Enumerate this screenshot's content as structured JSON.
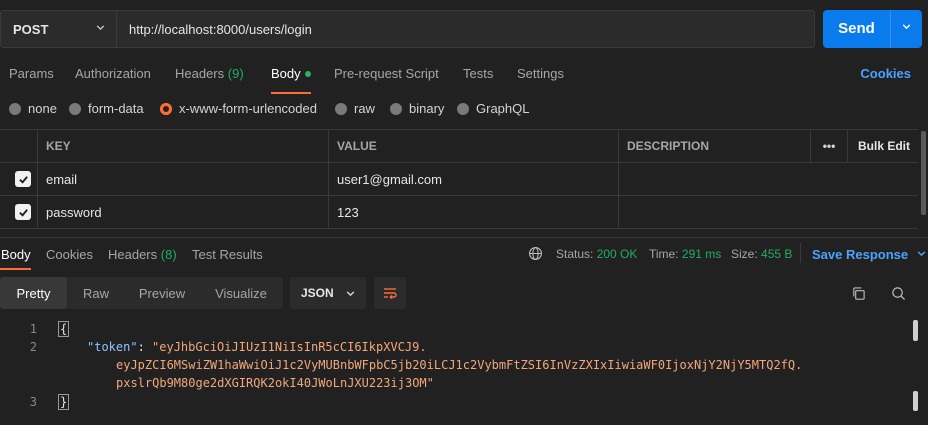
{
  "request": {
    "method": "POST",
    "url": "http://localhost:8000/users/login",
    "send_label": "Send"
  },
  "request_tabs": {
    "params": "Params",
    "authorization": "Authorization",
    "headers": "Headers",
    "headers_count": "(9)",
    "body": "Body",
    "prerequest": "Pre-request Script",
    "tests": "Tests",
    "settings": "Settings",
    "cookies": "Cookies"
  },
  "body_types": {
    "none": "none",
    "form_data": "form-data",
    "urlencoded": "x-www-form-urlencoded",
    "raw": "raw",
    "binary": "binary",
    "graphql": "GraphQL",
    "selected": "x-www-form-urlencoded"
  },
  "params_table": {
    "headers": {
      "key": "KEY",
      "value": "VALUE",
      "description": "DESCRIPTION",
      "more": "•••",
      "bulk_edit": "Bulk Edit"
    },
    "rows": [
      {
        "key": "email",
        "value": "user1@gmail.com",
        "checked": true
      },
      {
        "key": "password",
        "value": "123",
        "checked": true
      }
    ]
  },
  "response_tabs": {
    "body": "Body",
    "cookies": "Cookies",
    "headers": "Headers",
    "headers_count": "(8)",
    "test_results": "Test Results"
  },
  "response_meta": {
    "status_label": "Status:",
    "status_value": "200 OK",
    "time_label": "Time:",
    "time_value": "291 ms",
    "size_label": "Size:",
    "size_value": "455 B",
    "save_response": "Save Response"
  },
  "view_modes": {
    "pretty": "Pretty",
    "raw": "Raw",
    "preview": "Preview",
    "visualize": "Visualize",
    "format": "JSON"
  },
  "response_body": {
    "line_numbers": [
      "1",
      "2",
      "3"
    ],
    "open_brace": "{",
    "close_brace": "}",
    "token_key": "\"token\"",
    "colon": ": ",
    "token_line_1": "\"eyJhbGciOiJIUzI1NiIsInR5cCI6IkpXVCJ9.",
    "token_line_2": "eyJpZCI6MSwiZW1haWwiOiJ1c2VyMUBnbWFpbC5jb20iLCJ1c2VybmFtZSI6InVzZXIxIiwiaWF0IjoxNjY2NjY5MTQ2fQ.",
    "token_line_3": "pxslrQb9M80ge2dXGIRQK2okI40JWoLnJXU223ij3OM\""
  },
  "colors": {
    "accent": "#ff6c37",
    "send": "#097bed",
    "link": "#4aa3ff",
    "success": "#1fae62"
  }
}
